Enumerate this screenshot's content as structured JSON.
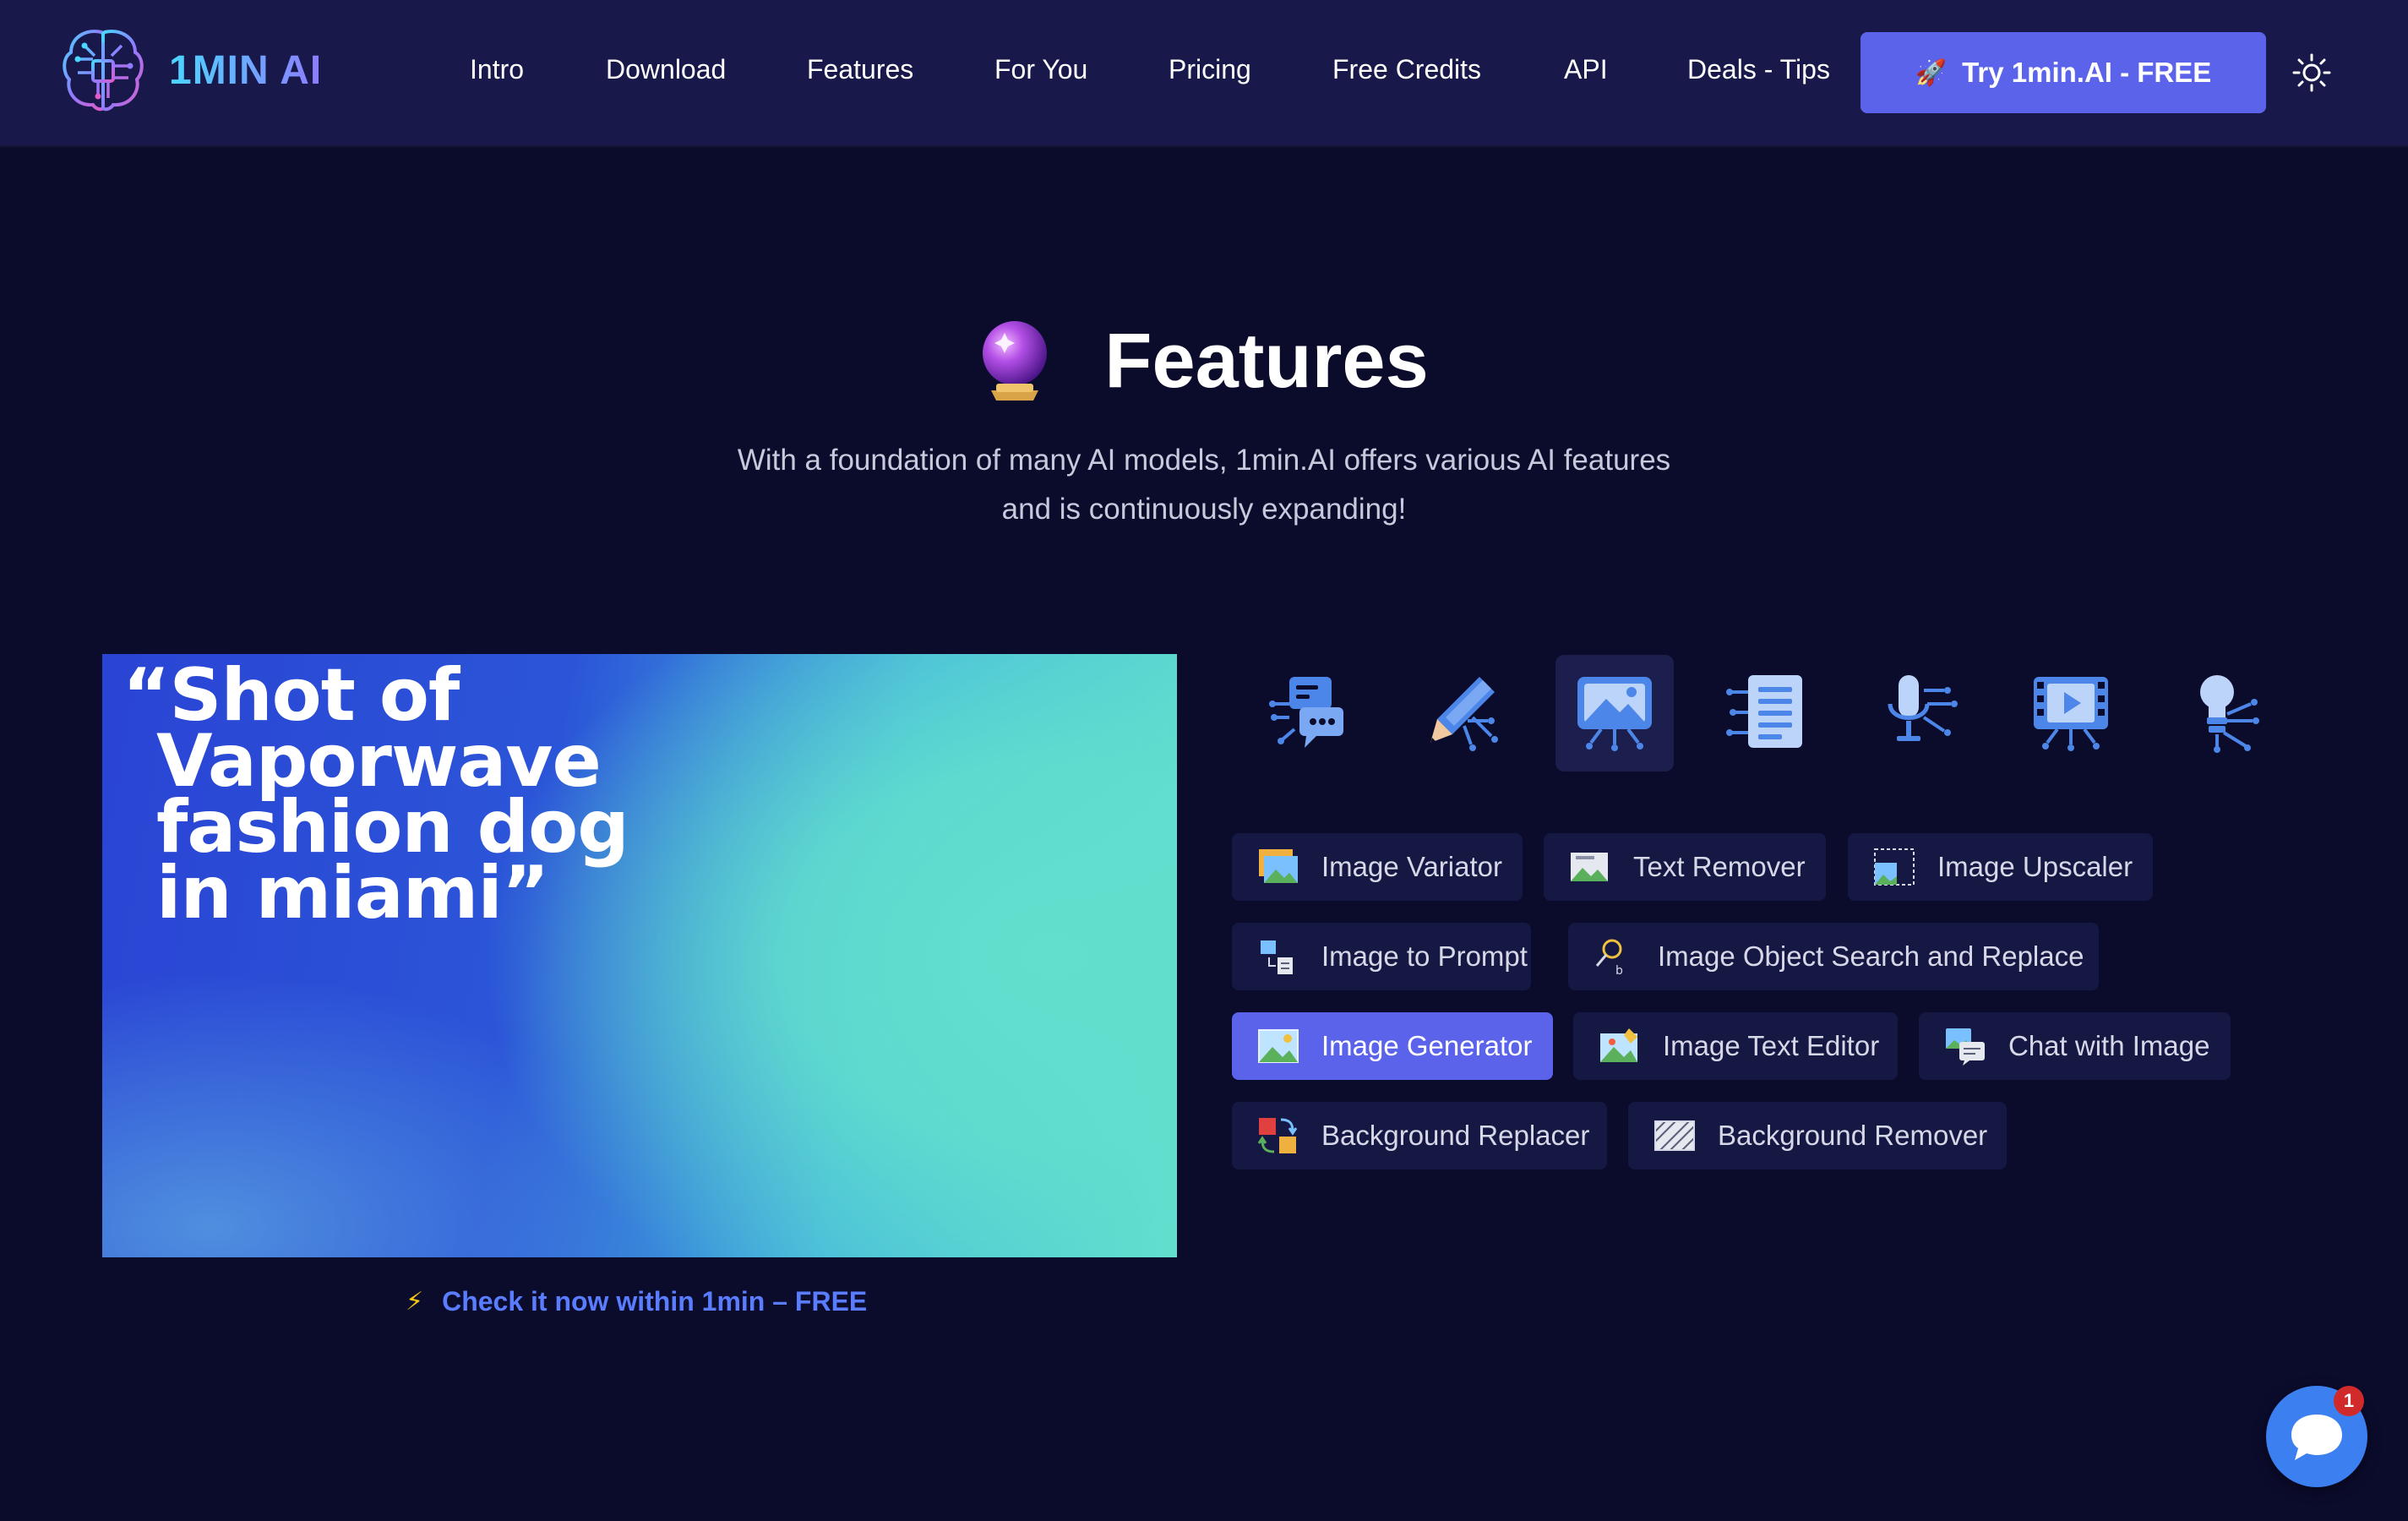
{
  "brand": {
    "name": "1MIN AI"
  },
  "nav": {
    "items": [
      "Intro",
      "Download",
      "Features",
      "For You",
      "Pricing",
      "Free Credits",
      "API",
      "Deals - Tips"
    ],
    "cta_label": "Try 1min.AI - FREE",
    "cta_icon": "rocket-icon",
    "theme_toggle_icon": "sun-icon"
  },
  "section": {
    "title": "Features",
    "title_icon": "crystal-ball-icon",
    "subtitle_line1": "With a foundation of many AI models, 1min.AI offers various AI features",
    "subtitle_line2": "and is continuously expanding!"
  },
  "preview": {
    "quote_lines": [
      "“Shot of",
      "Vaporwave",
      "fashion dog",
      "in miami”"
    ],
    "link_label": "Check it now within 1min – FREE",
    "link_icon": "lightning-icon"
  },
  "categories": [
    {
      "name": "chat-category",
      "icon": "chat-icon",
      "active": false
    },
    {
      "name": "writing-category",
      "icon": "pencil-icon",
      "active": false
    },
    {
      "name": "image-category",
      "icon": "image-icon",
      "active": true
    },
    {
      "name": "document-category",
      "icon": "document-icon",
      "active": false
    },
    {
      "name": "audio-category",
      "icon": "microphone-icon",
      "active": false
    },
    {
      "name": "video-category",
      "icon": "video-icon",
      "active": false
    },
    {
      "name": "idea-category",
      "icon": "lightbulb-icon",
      "active": false
    }
  ],
  "features": {
    "row1": [
      "Image Variator",
      "Text Remover",
      "Image Upscaler"
    ],
    "row2": [
      "Image to Prompt",
      "Image Object Search and Replace"
    ],
    "row3": [
      "Image Generator",
      "Image Text Editor",
      "Chat with Image"
    ],
    "row4": [
      "Background Replacer",
      "Background Remover"
    ],
    "active": "Image Generator"
  },
  "chat_widget": {
    "badge_count": "1",
    "icon": "chat-bubble-icon"
  },
  "colors": {
    "background": "#0b0b2c",
    "nav_background": "#18194a",
    "accent": "#5b63ea",
    "link": "#5a7cff",
    "icon_blue": "#4c86e8"
  }
}
